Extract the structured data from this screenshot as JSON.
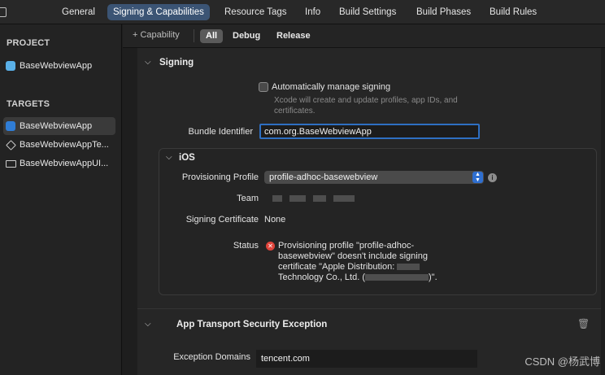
{
  "tabs": [
    "General",
    "Signing & Capabilities",
    "Resource Tags",
    "Info",
    "Build Settings",
    "Build Phases",
    "Build Rules"
  ],
  "active_tab": "Signing & Capabilities",
  "sidebar": {
    "project_header": "PROJECT",
    "project_item": "BaseWebviewApp",
    "targets_header": "TARGETS",
    "targets": [
      "BaseWebviewApp",
      "BaseWebviewAppTe...",
      "BaseWebviewAppUI..."
    ]
  },
  "filterbar": {
    "add_capability": "+ Capability",
    "filters": [
      "All",
      "Debug",
      "Release"
    ],
    "active_filter": "All"
  },
  "signing": {
    "title": "Signing",
    "auto_manage_label": "Automatically manage signing",
    "auto_manage_hint": "Xcode will create and update profiles, app IDs, and certificates.",
    "auto_manage_checked": false,
    "bundle_identifier_label": "Bundle Identifier",
    "bundle_identifier_value": "com.org.BaseWebviewApp",
    "ios": {
      "title": "iOS",
      "provisioning_label": "Provisioning Profile",
      "provisioning_value": "profile-adhoc-basewebview",
      "team_label": "Team",
      "signing_cert_label": "Signing Certificate",
      "signing_cert_value": "None",
      "status_label": "Status",
      "status_line1": "Provisioning profile \"profile-adhoc-",
      "status_line2": "basewebview\" doesn't include signing",
      "status_line3": "certificate \"Apple Distribution:",
      "status_line4_a": "Technology Co., Ltd. (",
      "status_line4_b": ")\"."
    }
  },
  "ats": {
    "title": "App Transport Security Exception",
    "exception_domains_label": "Exception Domains",
    "exception_domains_value": "tencent.com"
  },
  "watermark": "CSDN @杨武博",
  "colors": {
    "accent": "#2f6fd0",
    "active_tab_bg": "#3b5474",
    "error": "#e0443b"
  },
  "icons": [
    "sidebar-toggle-icon",
    "app-icon",
    "test-target-icon",
    "ui-test-target-icon",
    "chevron-down-icon",
    "info-icon",
    "error-icon",
    "trash-icon"
  ]
}
